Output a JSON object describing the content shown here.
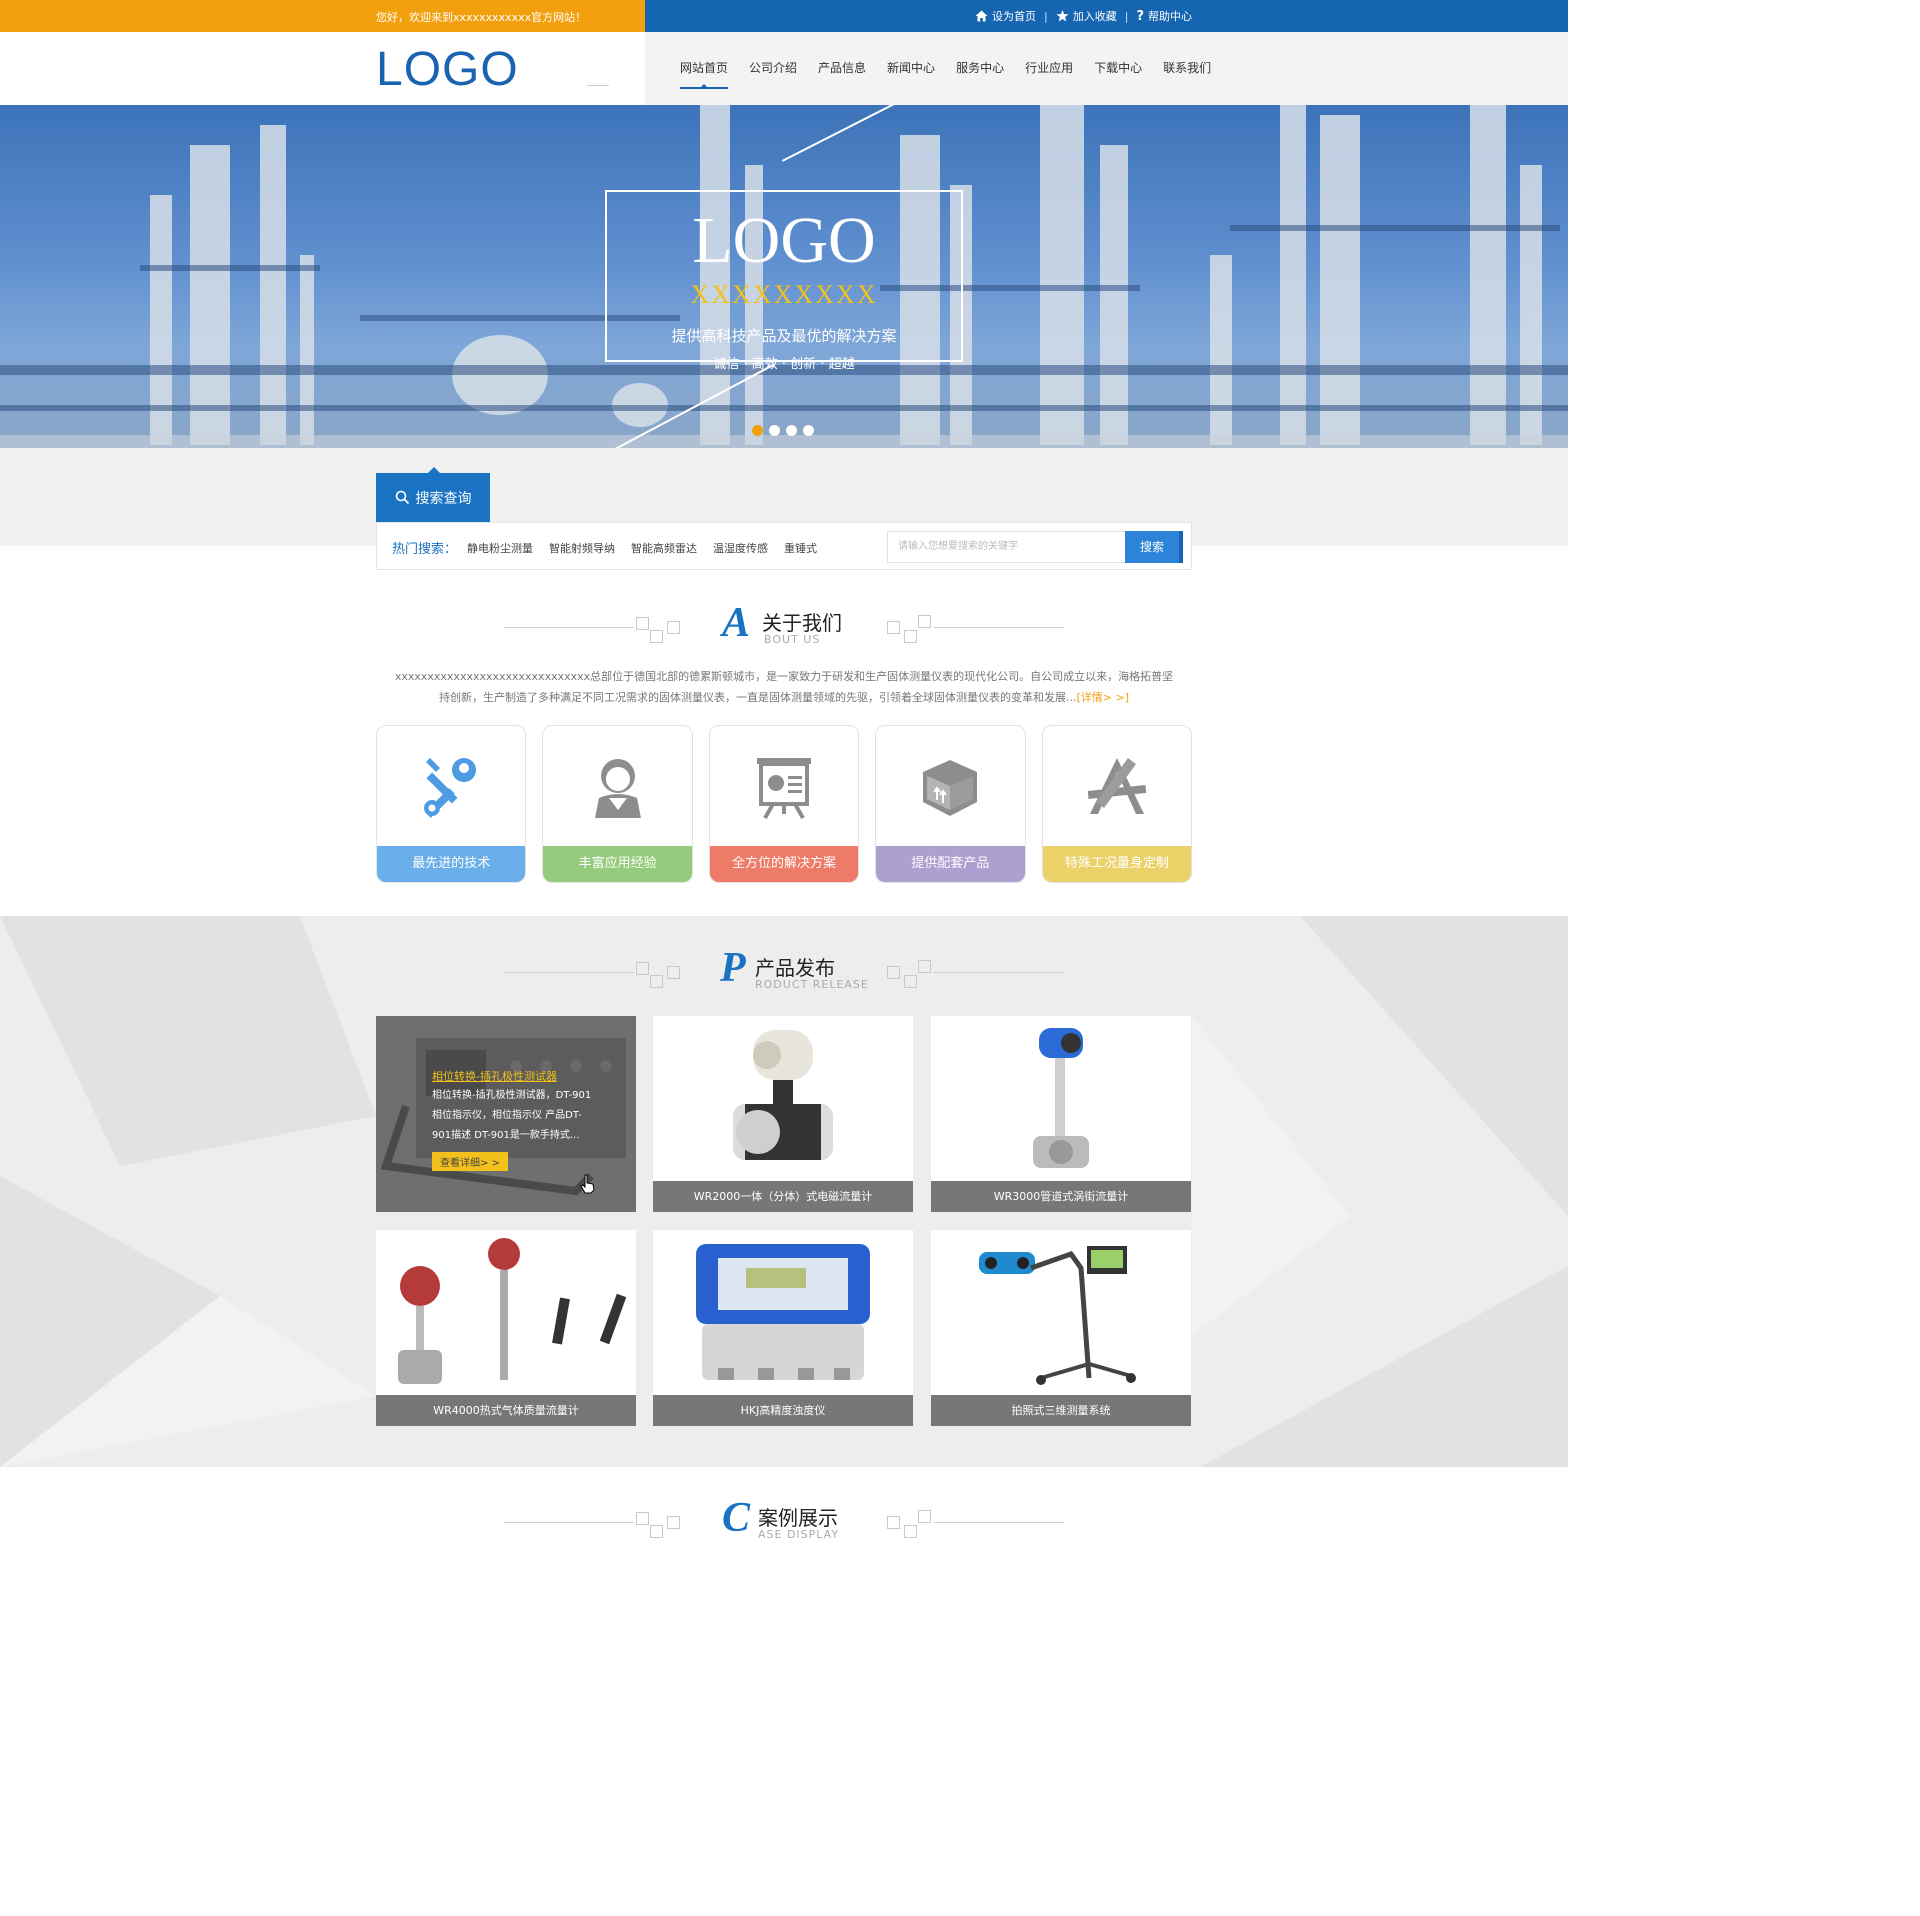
{
  "topbar": {
    "welcome": "您好，欢迎来到xxxxxxxxxxxx官方网站！",
    "links": [
      {
        "label": "设为首页",
        "icon": "home-icon"
      },
      {
        "label": "加入收藏",
        "icon": "star-icon"
      },
      {
        "label": "帮助中心",
        "icon": "question-icon"
      }
    ]
  },
  "header": {
    "logo": "LOGO",
    "nav": [
      "网站首页",
      "公司介绍",
      "产品信息",
      "新闻中心",
      "服务中心",
      "行业应用",
      "下载中心",
      "联系我们"
    ],
    "active_nav": 0
  },
  "banner": {
    "logo": "LOGO",
    "subtitle": "XXXXXXXXX",
    "slogan": "提供高科技产品及最优的解决方案",
    "values": "诚信 · 高效 · 创新 · 超越",
    "slides": 4,
    "active_slide": 0
  },
  "search": {
    "tab_label": "搜索查询",
    "hot_label": "热门搜索：",
    "hot_items": [
      "静电粉尘测量",
      "智能射频导纳",
      "智能高频雷达",
      "温湿度传感",
      "重锤式"
    ],
    "placeholder": "请输入您想要搜索的关键字",
    "button": "搜索"
  },
  "about": {
    "letter": "A",
    "title": "关于我们",
    "subtitle": "BOUT US",
    "text": "xxxxxxxxxxxxxxxxxxxxxxxxxxxxxx总部位于德国北部的德累斯顿城市，是一家致力于研发和生产固体测量仪表的现代化公司。自公司成立以来，海格拓普坚持创新，生产制造了多种满足不同工况需求的固体测量仪表，一直是固体测量领域的先驱，引领着全球固体测量仪表的变革和发展...",
    "more": "[详情> >]",
    "cards": [
      {
        "label": "最先进的技术",
        "icon": "tools-icon",
        "color": "#6aaeea"
      },
      {
        "label": "丰富应用经验",
        "icon": "user-icon",
        "color": "#95cb7c"
      },
      {
        "label": "全方位的解决方案",
        "icon": "presentation-icon",
        "color": "#ee7a68"
      },
      {
        "label": "提供配套产品",
        "icon": "box-icon",
        "color": "#ad9fd0"
      },
      {
        "label": "特殊工况量身定制",
        "icon": "compass-ruler-icon",
        "color": "#ebd268"
      }
    ]
  },
  "products": {
    "letter": "P",
    "title": "产品发布",
    "subtitle": "RODUCT RELEASE",
    "hover": {
      "title": "相位转换-插孔极性测试器",
      "desc": "相位转换-插孔极性测试器，DT-901相位指示仪，相位指示仪 产品DT-901描述 DT-901是一款手持式...",
      "button": "查看详细> >"
    },
    "items": [
      {
        "label": "相位转换-插孔极性测试器"
      },
      {
        "label": "WR2000一体（分体）式电磁流量计"
      },
      {
        "label": "WR3000管道式涡街流量计"
      },
      {
        "label": "WR4000热式气体质量流量计"
      },
      {
        "label": "HKJ高精度浊度仪"
      },
      {
        "label": "拍照式三维测量系统"
      }
    ]
  },
  "cases": {
    "letter": "C",
    "title": "案例展示",
    "subtitle": "ASE DISPLAY"
  }
}
